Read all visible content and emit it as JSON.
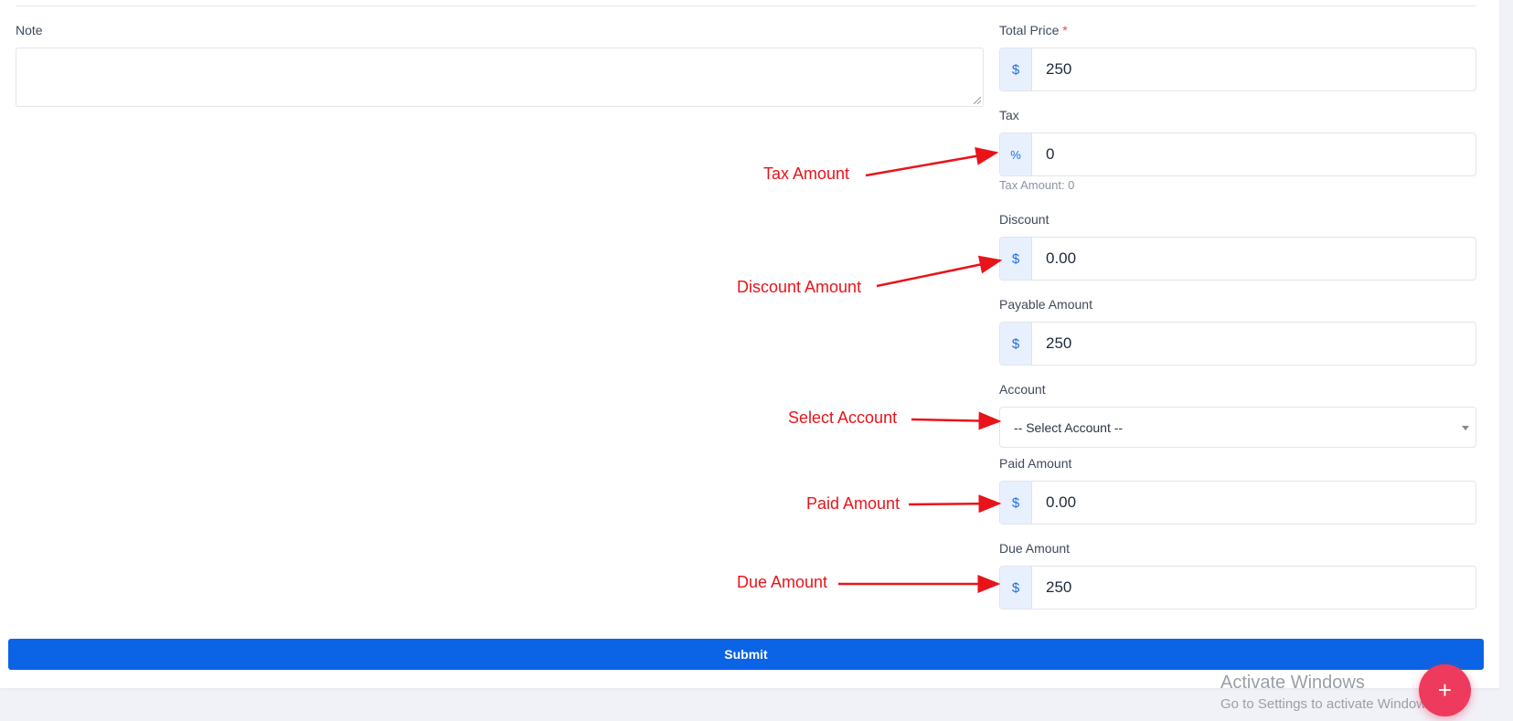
{
  "form": {
    "note": {
      "label": "Note",
      "value": ""
    },
    "total_price": {
      "label": "Total Price",
      "required_mark": "*",
      "prefix": "$",
      "value": "250"
    },
    "tax": {
      "label": "Tax",
      "prefix": "%",
      "value": "0",
      "helper": "Tax Amount: 0"
    },
    "discount": {
      "label": "Discount",
      "prefix": "$",
      "value": "0.00"
    },
    "payable_amount": {
      "label": "Payable Amount",
      "prefix": "$",
      "value": "250"
    },
    "account": {
      "label": "Account",
      "selected": "-- Select Account --"
    },
    "paid_amount": {
      "label": "Paid Amount",
      "prefix": "$",
      "value": "0.00"
    },
    "due_amount": {
      "label": "Due Amount",
      "prefix": "$",
      "value": "250"
    },
    "submit_label": "Submit"
  },
  "annotations": {
    "tax": "Tax Amount",
    "discount": "Discount Amount",
    "account": "Select Account",
    "paid": "Paid Amount",
    "due": "Due Amount",
    "color": "#e8141a"
  },
  "fab": {
    "icon": "plus-icon",
    "label": "+"
  },
  "watermark": {
    "line1": "Activate Windows",
    "line2": "Go to Settings to activate Windows."
  },
  "colors": {
    "primary": "#0b63e5",
    "fab": "#ee3a5c",
    "addon_bg": "#e8f0fe"
  }
}
